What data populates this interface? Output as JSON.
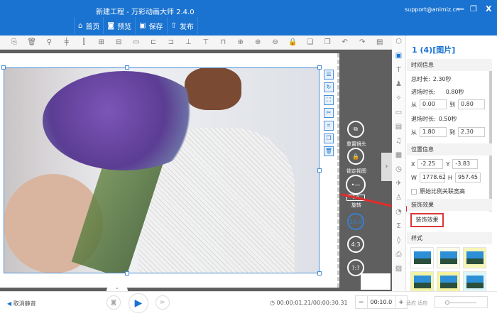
{
  "window": {
    "title": "新建工程 - 万彩动画大师 2.4.0",
    "email": "support@animiz.cn",
    "minimize": "—",
    "maximize": "❐",
    "close": "X"
  },
  "menu": [
    {
      "icon": "home-icon",
      "glyph": "⌂",
      "label": "首页"
    },
    {
      "icon": "preview-icon",
      "glyph": "◙",
      "label": "预览"
    },
    {
      "icon": "save-icon",
      "glyph": "▣",
      "label": "保存"
    },
    {
      "icon": "publish-icon",
      "glyph": "⇧",
      "label": "发布"
    }
  ],
  "toolbar": [
    "⎘",
    "🗑",
    "⚲",
    "╪",
    "⫿",
    "⊞",
    "⊟",
    "▭",
    "⊏",
    "⊐",
    "⊥",
    "⊤",
    "⊓",
    "⊕",
    "⊕",
    "⊖",
    "🔒",
    "❏",
    "❐",
    "↶",
    "↷",
    "▤"
  ],
  "camera": {
    "reset_label": "重置镜头",
    "lock_label": "锁定视图",
    "rotate_label": "旋转",
    "rotate_value": "0.0",
    "ratios": [
      "16:9",
      "4:3",
      "?:?"
    ],
    "active_ratio": "16:9"
  },
  "panel": {
    "title": "1 (4)[图片]",
    "time_section": "时间信息",
    "total_label": "总时长:",
    "total_value": "2.30秒",
    "enter_label": "进场时长:",
    "enter_value": "0.80秒",
    "from_label": "从",
    "to_label": "到",
    "enter_from": "0.00",
    "enter_to": "0.80",
    "exit_label": "退场时长:",
    "exit_value": "0.50秒",
    "exit_from": "1.80",
    "exit_to": "2.30",
    "pos_section": "位置信息",
    "x_label": "X",
    "x": "-2.25",
    "y_label": "Y",
    "y": "-3.83",
    "w_label": "W",
    "w": "1778.62",
    "h_label": "H",
    "h": "957.45",
    "ratio_label": "原始比例关联宽高",
    "decor_section": "装饰效果",
    "decor_button": "装饰效果",
    "style_section": "样式"
  },
  "colors": {
    "accent": "#1a73d0",
    "annotation": "#e52b2b"
  },
  "bottom": {
    "mute": "取消静音",
    "time": "00:00:01.21/00:00:30.31",
    "zoom_value": "00:10.0",
    "minus": "−",
    "plus": "+",
    "fit": "适应 适应"
  }
}
